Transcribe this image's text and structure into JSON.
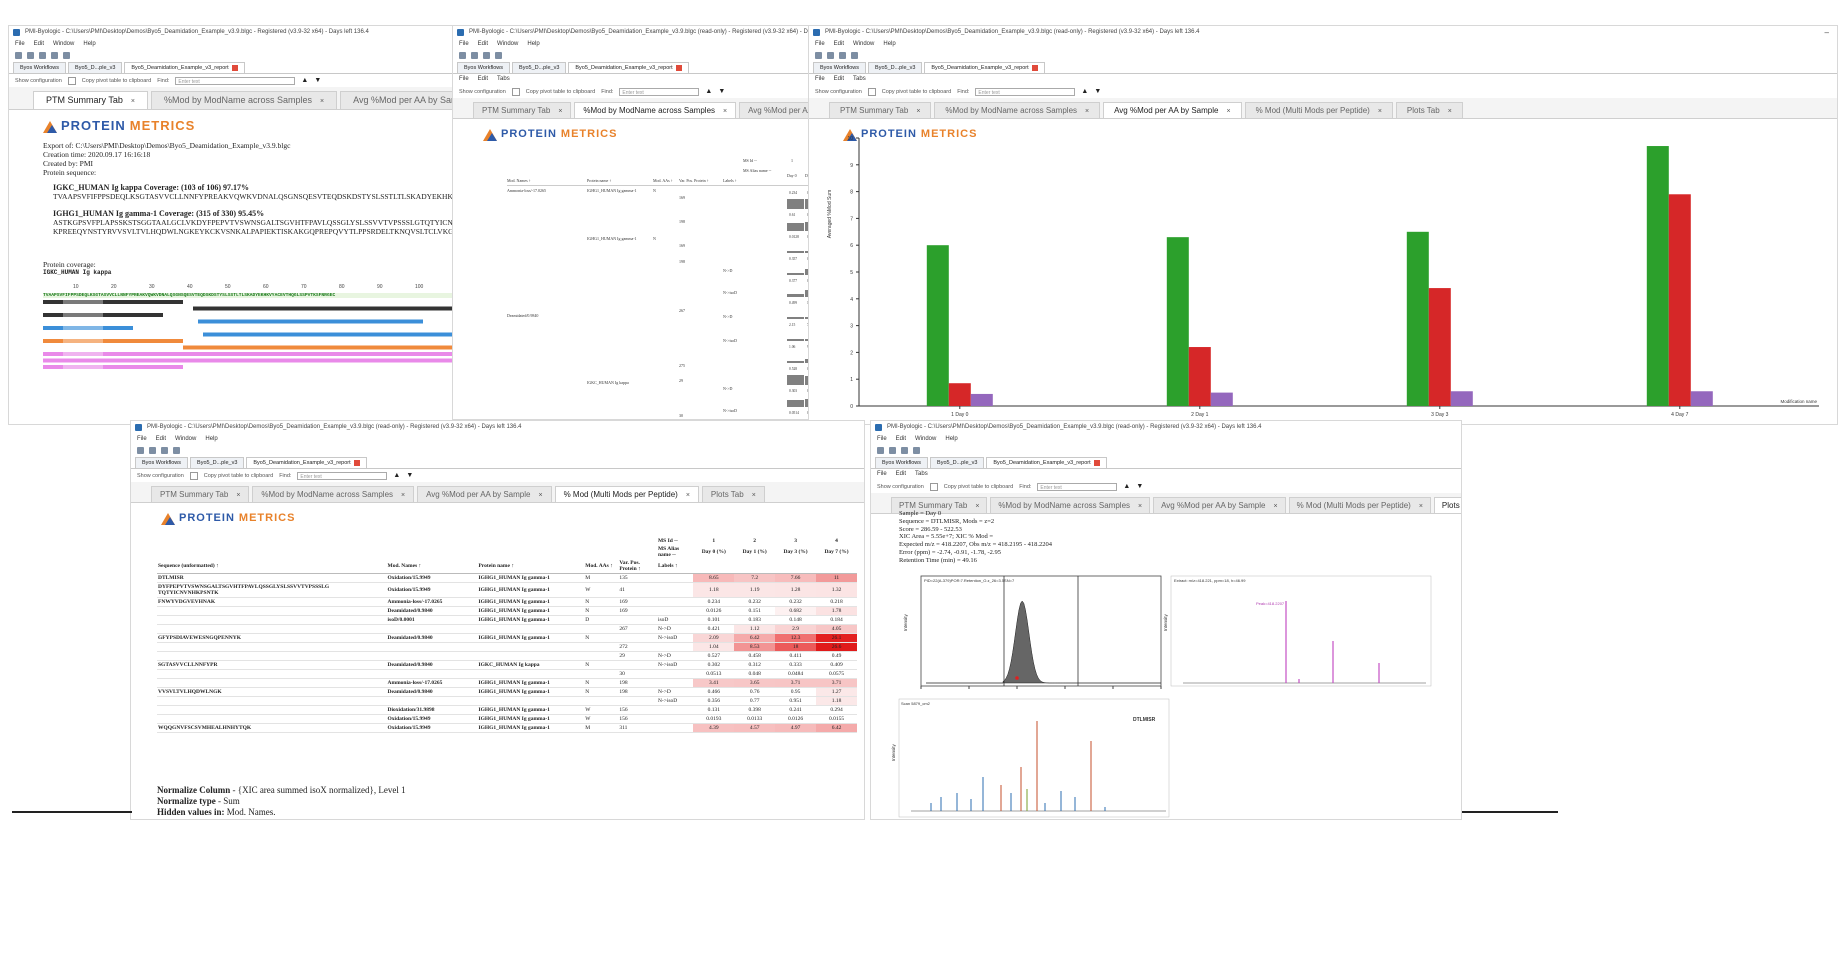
{
  "app": {
    "title_main": "PMI-Byologic - C:\\Users\\PMI\\Desktop\\Demos\\Byo5_Deamidation_Example_v3.9.blgc - Registered (v3.9-32 x64) - Days left 136.4",
    "title_ro": "PMI-Byologic - C:\\Users\\PMI\\Desktop\\Demos\\Byo5_Deamidation_Example_v3.9.blgc (read-only) - Registered (v3.9-32 x64) - Days left 136.4",
    "menu": [
      "File",
      "Edit",
      "Window",
      "Help"
    ],
    "menu_short": [
      "File",
      "Edit",
      "Tabs"
    ],
    "editor_tabs": [
      "Byos Workflows",
      "Byo5_D...ple_v3",
      "Byo5_Deamidation_Example_v3_report"
    ],
    "show_config": "Show configuration",
    "copy_pivot": "Copy pivot table to clipboard",
    "find_label": "Find:",
    "find_placeholder": "Enter text"
  },
  "tabs": {
    "ptm_summary": "PTM Summary Tab",
    "mod_by_name": "%Mod by ModName across Samples",
    "avg_mod": "Avg %Mod per AA by Sample",
    "avg_mod_trunc": "Avg %Mod per AA by Sa",
    "avg_mod_trunc2": "Avg %Mod per AA by Samp",
    "multi_mods": "% Mod (Multi Mods per Peptide)",
    "plots": "Plots Tab",
    "close_glyph": "×"
  },
  "logo": {
    "word1": "PROTEIN",
    "word2": "METRICS"
  },
  "summary": {
    "export_of": "Export of: C:\\Users\\PMI\\Desktop\\Demos\\Byo5_Deamidation_Example_v3.9.blgc",
    "creation_time": "Creation time: 2020.09.17 16:16:18",
    "created_by": "Created by: PMI",
    "protein_sequence": "Protein sequence:",
    "igkc_title": "IGKC_HUMAN Ig kappa Coverage: (103 of 106) 97.17%",
    "igkc_seq": "TVAAPSVFIFPPSDEQLKSGTASVVCLLNNFYPREAKVQWKVDNALQSGNSQESVTEQDSKDSTYSLSSTLTLSKADYEKHKVY",
    "ighg1_title": "IGHG1_HUMAN Ig gamma-1 Coverage: (315 of 330) 95.45%",
    "ighg1_seq1": "ASTKGPSVFPLAPSSKSTSGGTAALGCLVKDYFPEPVTVSWNSGALTSGVHTFPAVLQSSGLYSLSSVVTVPSSSLGTQTYICNV",
    "ighg1_seq2": "KPREEQYNSTYRVVSVLTVLHQDWLNGKEYKCKVSNKALPAPIEKTISKAKGQPREPQVYTLPPSRDELTKNQVSLTCLVKGF",
    "protein_coverage": "Protein coverage:",
    "coverage_name": "IGKC_HUMAN Ig kappa",
    "ruler": [
      "10",
      "20",
      "30",
      "40",
      "50",
      "60",
      "70",
      "80",
      "90",
      "100"
    ],
    "coverage_seq": "TVAAPSVFIFPPSDEQLKSGTASVVCLLNNFYPREAKVQWKVDNALQSGNSQESVTEQDSKDSTYSLSSTLTLSKADYEKHKVYACEVTHQGLSSPVTKSFNRGEC"
  },
  "pivot": {
    "col_ms_id": "MS Id --",
    "col_ms_alias": "MS Alias name --",
    "col_nums": [
      "1",
      "2",
      "3",
      "4"
    ],
    "days": [
      "Day 0",
      "Day 1",
      "Day 3",
      "Day 7"
    ],
    "headers": [
      "Mod. Names ↑",
      "Protein name ↑",
      "Mod. AAs ↑",
      "Var. Pos. Protein ↑",
      "Labels ↑"
    ],
    "groups": [
      "Ammonia-loss/-17.0265",
      "Deamidated/0.9840"
    ],
    "proteins": [
      "IGHG1_HUMAN Ig gamma-1",
      "IGHG1_HUMAN Ig gamma-1",
      "IGKC_HUMAN Ig kappa"
    ],
    "aas": [
      "N",
      "N"
    ],
    "positions": [
      "169",
      "198",
      "169",
      "198",
      "267",
      "275",
      "29",
      "30"
    ],
    "labels": [
      "N->D",
      "N->isoD",
      "N->D",
      "N->isoD",
      "N->D",
      "N->isoD"
    ],
    "rows": [
      [
        "0.234",
        "0.233",
        "0.233",
        "0.218"
      ],
      [
        "0.61",
        "0.72",
        "0.79",
        "0.81"
      ],
      [
        "0.0128",
        "0.151",
        "0.682",
        "1.78"
      ],
      [
        "0.357",
        "0.787",
        "0.808",
        "1.43"
      ],
      [
        "0.377",
        "0.868",
        "0.96",
        "1.21"
      ],
      [
        "0.499",
        "1.51",
        "4.15",
        "8.67"
      ],
      [
        "2.15",
        "7.08",
        "13.6",
        "28.5"
      ],
      [
        "1.06",
        "9.61",
        "22.2",
        "26.6"
      ],
      [
        "0.528",
        "0.456",
        "0.421",
        "0.402"
      ],
      [
        "0.303",
        "0.314",
        "0.327",
        "0.413"
      ],
      [
        "0.0514",
        "0.0465",
        "0.0407",
        "0.036"
      ]
    ]
  },
  "bar_chart": {
    "y_label": "Averaged %Mod Sum",
    "y_ticks": [
      "0",
      "1",
      "2",
      "3",
      "4",
      "5",
      "6",
      "7",
      "8",
      "9",
      "10"
    ],
    "categories": [
      "1 Day 0",
      "2 Day 1",
      "3 Day 3",
      "4 Day 7"
    ],
    "corner": "Modification name",
    "colors": [
      "#2ca02c",
      "#d62728",
      "#9467bd"
    ]
  },
  "chart_data": {
    "type": "bar",
    "categories": [
      "1 Day 0",
      "2 Day 1",
      "3 Day 3",
      "4 Day 7"
    ],
    "ylabel": "Averaged %Mod Sum",
    "ylim": [
      0,
      10
    ],
    "series": [
      {
        "values": [
          6.0,
          6.3,
          6.5,
          9.7
        ],
        "color": "#2ca02c"
      },
      {
        "values": [
          0.85,
          2.2,
          4.4,
          7.9
        ],
        "color": "#d62728"
      },
      {
        "values": [
          0.45,
          0.5,
          0.55,
          0.55
        ],
        "color": "#9467bd"
      }
    ]
  },
  "multi": {
    "headers": [
      "Sequence (unformatted) ↑",
      "Mod. Names ↑",
      "Protein name ↑",
      "Mod. AAs ↑",
      "Var. Pos. Protein ↑",
      "Labels ↑"
    ],
    "ms_id": "MS Id --",
    "ms_alias": "MS Alias name --",
    "col_nums": [
      "1",
      "2",
      "3",
      "4"
    ],
    "days": [
      "Day 0 (%)",
      "Day 1 (%)",
      "Day 3 (%)",
      "Day 7 (%)"
    ],
    "rows": [
      {
        "seq": "DTLMISR",
        "mod": "Oxidation/15.9949",
        "prot": "IGHG1_HUMAN Ig gamma-1",
        "aa": "M",
        "pos": "135",
        "lab": "",
        "v": [
          "8.65",
          "7.2",
          "7.66",
          "11"
        ],
        "c": [
          "#f7b9b9",
          "#f7c4c4",
          "#f7bcbc",
          "#f29a9a"
        ]
      },
      {
        "seq": "DYFPEPVTVSWNSGALTSGVHTFPAVLQSSGLYSLSSVVTVPSSSLG TQTYICNVNHKPSNTK",
        "mod": "Oxidation/15.9949",
        "prot": "IGHG1_HUMAN Ig gamma-1",
        "aa": "W",
        "pos": "41",
        "lab": "",
        "v": [
          "1.18",
          "1.19",
          "1.28",
          "1.32"
        ],
        "c": [
          "#fbe6e6",
          "#fbe6e6",
          "#fbe5e5",
          "#fbe4e4"
        ]
      },
      {
        "seq": "FNWYVDGVEVHNAK",
        "mod": "Ammonia-loss/-17.0265",
        "prot": "IGHG1_HUMAN Ig gamma-1",
        "aa": "N",
        "pos": "169",
        "lab": "",
        "v": [
          "0.234",
          "0.232",
          "0.232",
          "0.218"
        ],
        "c": [
          "#fff",
          "#fff",
          "#fff",
          "#fff"
        ]
      },
      {
        "seq": "",
        "mod": "Deamidated/0.9840",
        "prot": "IGHG1_HUMAN Ig gamma-1",
        "aa": "N",
        "pos": "169",
        "lab": "",
        "v": [
          "0.0126",
          "0.151",
          "0.682",
          "1.78"
        ],
        "c": [
          "#fff",
          "#fff",
          "#fdf1f1",
          "#fbe2e2"
        ]
      },
      {
        "seq": "",
        "mod": "isoD/0.0001",
        "prot": "IGHG1_HUMAN Ig gamma-1",
        "aa": "D",
        "pos": "",
        "lab": "isoD",
        "v": [
          "0.101",
          "0.183",
          "0.148",
          "0.184"
        ],
        "c": [
          "#fff",
          "#fff",
          "#fff",
          "#fff"
        ]
      },
      {
        "seq": "",
        "mod": "",
        "prot": "",
        "aa": "",
        "pos": "267",
        "lab": "N->D",
        "v": [
          "0.421",
          "1.12",
          "2.9",
          "4.05"
        ],
        "c": [
          "#fff",
          "#fbe6e6",
          "#f9d3d3",
          "#f7c6c6"
        ]
      },
      {
        "seq": "GFYPSDIAVEWESNGQPENNYK",
        "mod": "Deamidated/0.9840",
        "prot": "IGHG1_HUMAN Ig gamma-1",
        "aa": "N",
        "pos": "",
        "lab": "N->isoD",
        "v": [
          "2.09",
          "6.42",
          "12.3",
          "26.1"
        ],
        "c": [
          "#f9d6d6",
          "#f5aaaa",
          "#f07070",
          "#e32020"
        ]
      },
      {
        "seq": "",
        "mod": "",
        "prot": "",
        "aa": "",
        "pos": "272",
        "lab": "",
        "v": [
          "1.04",
          "8.53",
          "18",
          "26.6"
        ],
        "c": [
          "#fbe6e6",
          "#f29494",
          "#ec5a5a",
          "#e01a1a"
        ]
      },
      {
        "seq": "",
        "mod": "",
        "prot": "",
        "aa": "",
        "pos": "29",
        "lab": "N->D",
        "v": [
          "0.527",
          "0.458",
          "0.411",
          "0.49"
        ],
        "c": [
          "#fff",
          "#fff",
          "#fff",
          "#fff"
        ]
      },
      {
        "seq": "SGTASVVCLLNNFYPR",
        "mod": "Deamidated/0.9840",
        "prot": "IGKC_HUMAN Ig kappa",
        "aa": "N",
        "pos": "",
        "lab": "N->isoD",
        "v": [
          "0.302",
          "0.312",
          "0.333",
          "0.409"
        ],
        "c": [
          "#fff",
          "#fff",
          "#fff",
          "#fff"
        ]
      },
      {
        "seq": "",
        "mod": "",
        "prot": "",
        "aa": "",
        "pos": "30",
        "lab": "",
        "v": [
          "0.0513",
          "0.048",
          "0.0484",
          "0.0575"
        ],
        "c": [
          "#fff",
          "#fff",
          "#fff",
          "#fff"
        ]
      },
      {
        "seq": "",
        "mod": "Ammonia-loss/-17.0265",
        "prot": "IGHG1_HUMAN Ig gamma-1",
        "aa": "N",
        "pos": "198",
        "lab": "",
        "v": [
          "3.41",
          "3.65",
          "3.71",
          "3.71"
        ],
        "c": [
          "#f7c8c8",
          "#f7c6c6",
          "#f7c5c5",
          "#f7c5c5"
        ]
      },
      {
        "seq": "VVSVLTVLHQDWLNGK",
        "mod": "Deamidated/0.9840",
        "prot": "IGHG1_HUMAN Ig gamma-1",
        "aa": "N",
        "pos": "198",
        "lab": "N->D",
        "v": [
          "0.466",
          "0.76",
          "0.95",
          "1.27"
        ],
        "c": [
          "#fff",
          "#fff",
          "#fff",
          "#fbe8e8"
        ]
      },
      {
        "seq": "",
        "mod": "",
        "prot": "",
        "aa": "",
        "pos": "",
        "lab": "N->isoD",
        "v": [
          "0.356",
          "0.77",
          "0.951",
          "1.18"
        ],
        "c": [
          "#fff",
          "#fff",
          "#fff",
          "#fbe8e8"
        ]
      },
      {
        "seq": "",
        "mod": "Dioxidation/31.9898",
        "prot": "IGHG1_HUMAN Ig gamma-1",
        "aa": "W",
        "pos": "156",
        "lab": "",
        "v": [
          "0.131",
          "0.398",
          "0.241",
          "0.294"
        ],
        "c": [
          "#fff",
          "#fff",
          "#fff",
          "#fff"
        ]
      },
      {
        "seq": "",
        "mod": "Oxidation/15.9949",
        "prot": "IGHG1_HUMAN Ig gamma-1",
        "aa": "W",
        "pos": "156",
        "lab": "",
        "v": [
          "0.0193",
          "0.0133",
          "0.0126",
          "0.0155"
        ],
        "c": [
          "#fff",
          "#fff",
          "#fff",
          "#fff"
        ]
      },
      {
        "seq": "WQQGNVFSCSVMHEALHNHYTQK",
        "mod": "Oxidation/15.9949",
        "prot": "IGHG1_HUMAN Ig gamma-1",
        "aa": "M",
        "pos": "311",
        "lab": "",
        "v": [
          "4.39",
          "4.57",
          "4.97",
          "6.42"
        ],
        "c": [
          "#f7c1c1",
          "#f7bfbf",
          "#f6bbbb",
          "#f4aaaa"
        ]
      }
    ],
    "normalize_column_label": "Normalize Column",
    "normalize_column_value": " - {XIC area summed isoX normalized}, Level 1",
    "normalize_type_label": "Normalize type",
    "normalize_type_value": " - Sum",
    "hidden_label": "Hidden values in:",
    "hidden_value": " Mod. Names."
  },
  "plots": {
    "info": [
      "Sample = Day 0",
      "Sequence = DTLMISR, Mods = z=2",
      "Score = 286.59 - 522.53",
      "XIC Area = 5.55e+7; XIC % Mod =",
      "Expected m/z = 418.2207, Obs m/z = 418.2195 - 418.2204",
      "Error (ppm) = -2.74, -0.91, -1.78, -2.95",
      "Retention Time (min) = 49.16"
    ],
    "xic_header": "PID=22(A-379)POR:7.Retention_O.z_26=3.5SN=7",
    "xic_xlabel": "Minutes",
    "xic_ylabel": "Intensity",
    "ms1_header": "Extract: m/z=418.221, ppm=18, h=46.99",
    "ms1_marker": "Peak=418.2207",
    "ms1_ylabel": "Intensity",
    "ms2_header": "Scan 5879_cm2",
    "ms2_ylabel": "Intensity",
    "ms2_seq": "DTLMISR"
  }
}
